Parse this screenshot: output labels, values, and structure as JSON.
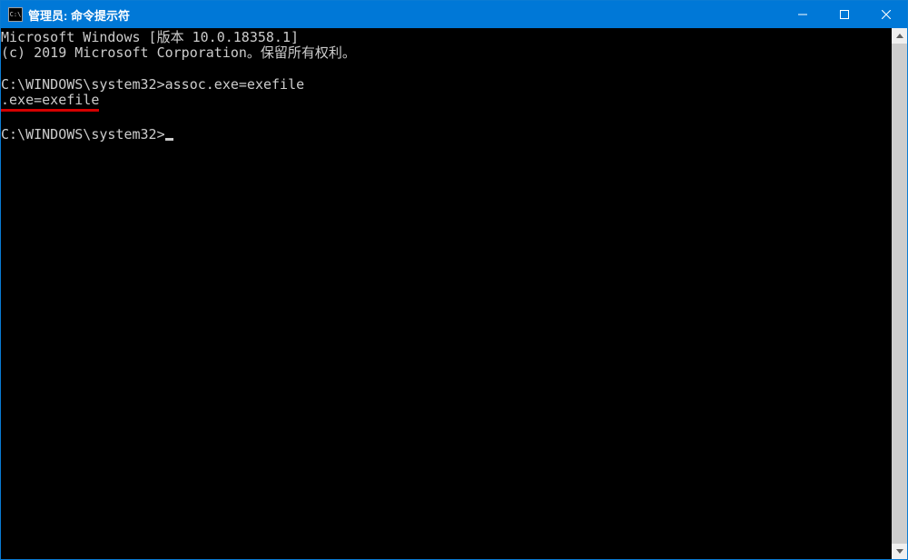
{
  "window": {
    "title": "管理员: 命令提示符"
  },
  "terminal": {
    "line1": "Microsoft Windows [版本 10.0.18358.1]",
    "line2": "(c) 2019 Microsoft Corporation。保留所有权利。",
    "prompt1_path": "C:\\WINDOWS\\system32>",
    "command1": "assoc.exe=exefile",
    "output1": ".exe=exefile",
    "prompt2_path": "C:\\WINDOWS\\system32>"
  }
}
